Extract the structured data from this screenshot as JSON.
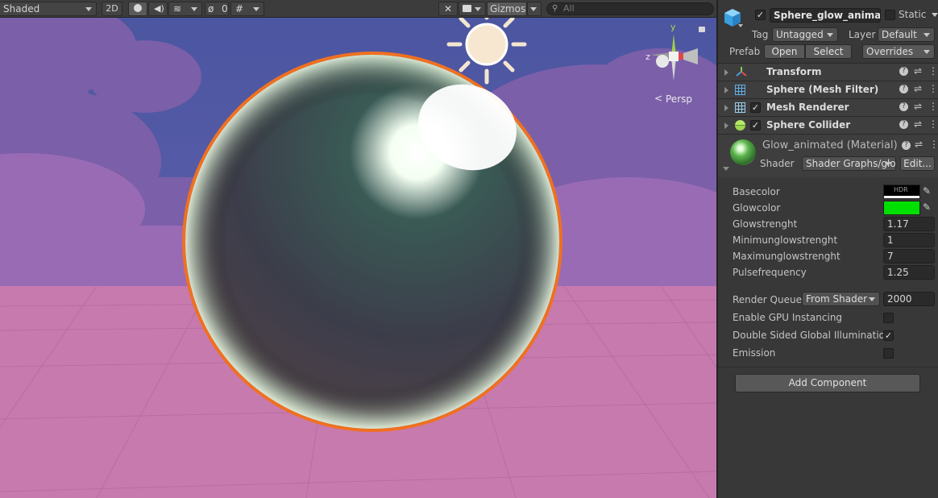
{
  "scene": {
    "toolbar": {
      "shading_mode": "Shaded",
      "mode_2d": "2D",
      "hidden_count": "0",
      "gizmos_label": "Gizmos",
      "search_placeholder": "All"
    },
    "gizmo": {
      "y_label": "y",
      "z_label": "z",
      "persp_label": "Persp"
    }
  },
  "inspector": {
    "object_name": "Sphere_glow_animated",
    "object_active": true,
    "static_label": "Static",
    "static_checked": false,
    "tag_label": "Tag",
    "tag_value": "Untagged",
    "layer_label": "Layer",
    "layer_value": "Default",
    "prefab_label": "Prefab",
    "prefab_open": "Open",
    "prefab_select": "Select",
    "prefab_overrides": "Overrides",
    "components": [
      {
        "name": "Transform",
        "icon": "transform-icon",
        "has_checkbox": false
      },
      {
        "name": "Sphere (Mesh Filter)",
        "icon": "mesh-filter-icon",
        "has_checkbox": false
      },
      {
        "name": "Mesh Renderer",
        "icon": "mesh-renderer-icon",
        "has_checkbox": true,
        "checked": true
      },
      {
        "name": "Sphere Collider",
        "icon": "sphere-collider-icon",
        "has_checkbox": true,
        "checked": true
      }
    ],
    "material": {
      "title": "Glow_animated (Material)",
      "shader_label": "Shader",
      "shader_value": "Shader Graphs/glow",
      "edit_label": "Edit...",
      "properties": [
        {
          "label": "Basecolor",
          "type": "color",
          "color": "#000000",
          "hdr": "HDR"
        },
        {
          "label": "Glowcolor",
          "type": "color",
          "color": "#00e000"
        },
        {
          "label": "Glowstrenght",
          "type": "float",
          "value": "1.17"
        },
        {
          "label": "Minimunglowstrenght",
          "type": "float",
          "value": "1"
        },
        {
          "label": "Maximunglowstrenght",
          "type": "float",
          "value": "7"
        },
        {
          "label": "Pulsefrequency",
          "type": "float",
          "value": "1.25"
        }
      ],
      "render_queue_label": "Render Queue",
      "render_queue_mode": "From Shader",
      "render_queue_value": "2000",
      "gpu_instancing_label": "Enable GPU Instancing",
      "gpu_instancing": false,
      "dsgi_label": "Double Sided Global Illumination",
      "dsgi": true,
      "emission_label": "Emission",
      "emission": false
    },
    "add_component": "Add Component"
  },
  "colors": {
    "sky_top": "#4f5aa0",
    "cloud": "#7a5fa8",
    "ground": "#c678ad",
    "outline": "#f07020",
    "glow": "#00e000"
  }
}
